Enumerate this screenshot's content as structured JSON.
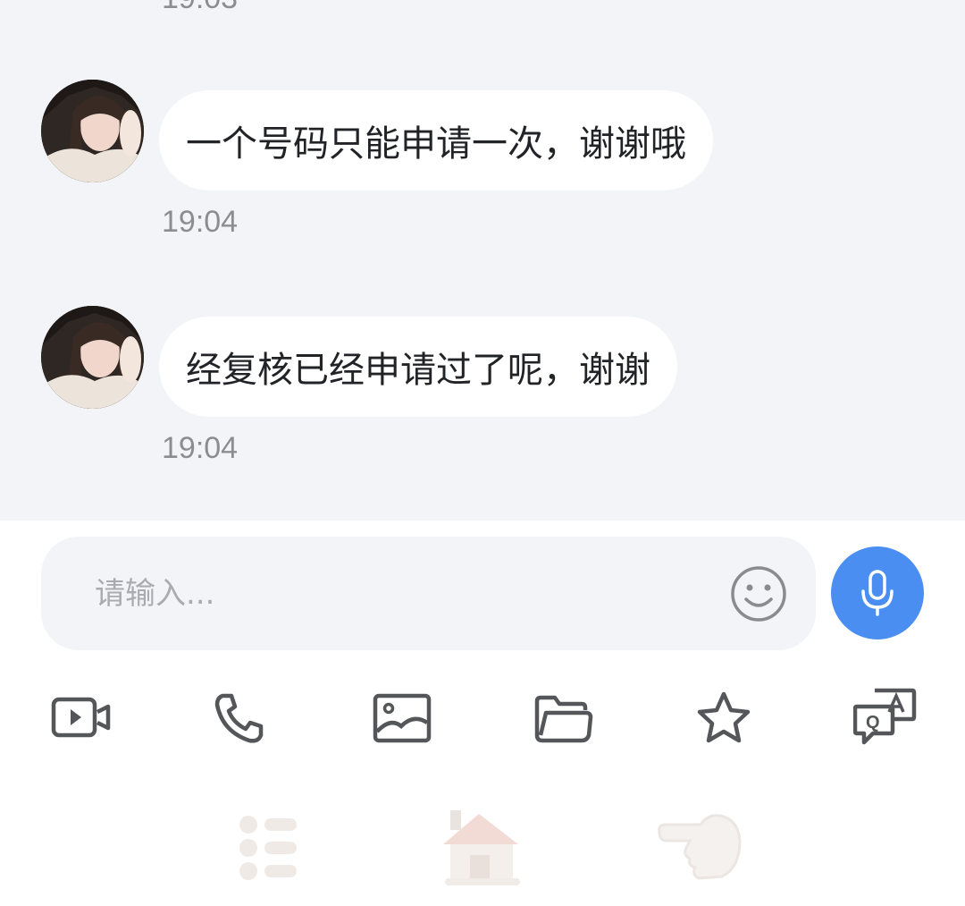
{
  "messages": [
    {
      "text": "一个号码只能申请一次，谢谢哦",
      "time": "19:04"
    },
    {
      "text": "经复核已经申请过了呢，谢谢",
      "time": "19:04"
    }
  ],
  "previous_time_partial": "19:03",
  "composer": {
    "placeholder": "请输入...",
    "emoji_icon": "smiley-face-icon",
    "voice_icon": "microphone-icon",
    "voice_color": "#4a8ef1"
  },
  "toolbar": [
    {
      "icon": "video-icon"
    },
    {
      "icon": "phone-icon"
    },
    {
      "icon": "image-icon"
    },
    {
      "icon": "folder-icon"
    },
    {
      "icon": "star-icon"
    },
    {
      "icon": "translate-qa-icon"
    }
  ],
  "bottom_nav": [
    {
      "icon": "menu-list-icon"
    },
    {
      "icon": "house-icon"
    },
    {
      "icon": "pointing-hand-icon"
    }
  ]
}
